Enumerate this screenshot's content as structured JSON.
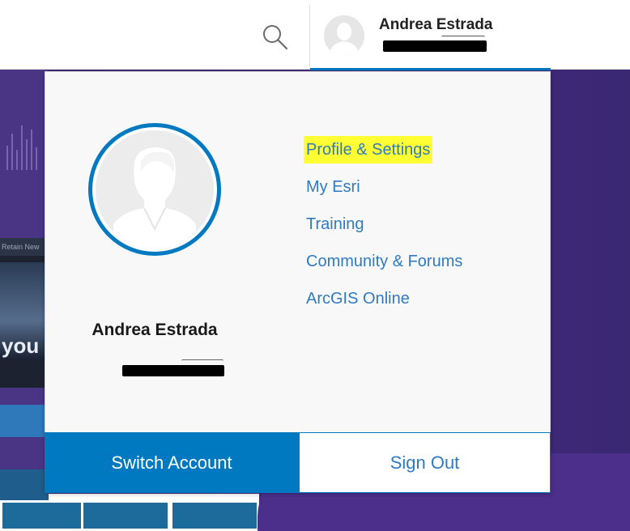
{
  "header": {
    "user_name": "Andrea Estrada"
  },
  "panel": {
    "user_name": "Andrea Estrada",
    "menu": [
      {
        "label": "Profile & Settings"
      },
      {
        "label": "My Esri"
      },
      {
        "label": "Training"
      },
      {
        "label": "Community & Forums"
      },
      {
        "label": "ArcGIS Online"
      }
    ],
    "switch_label": "Switch Account",
    "signout_label": "Sign Out"
  },
  "background": {
    "card_header_text": "Retain New",
    "hero_word": "you"
  },
  "colors": {
    "accent": "#0079c1",
    "link": "#2f7bc1",
    "highlight": "#ffff33",
    "hero": "#432a7e"
  }
}
